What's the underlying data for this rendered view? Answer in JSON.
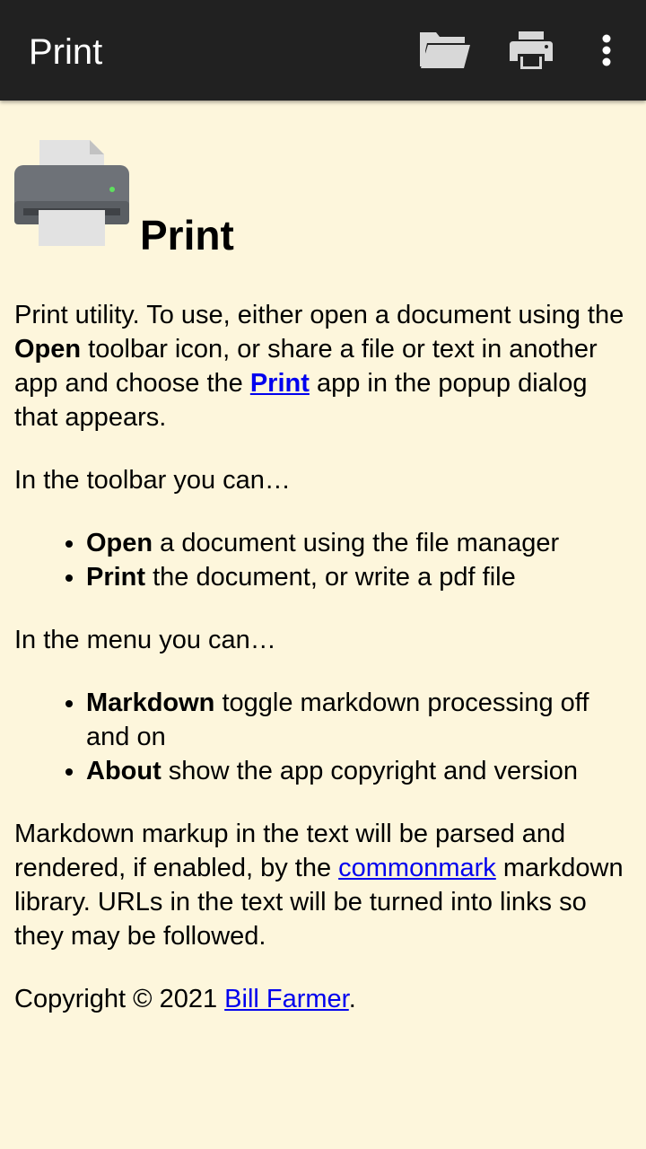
{
  "toolbar": {
    "title": "Print",
    "icons": [
      "folder-open-icon",
      "print-icon",
      "more-vert-icon"
    ]
  },
  "header": {
    "icon": "printer-icon",
    "title": "Print"
  },
  "intro": {
    "t1": "Print utility. To use, either open a document using the ",
    "open_bold": "Open",
    "t2": " toolbar icon, or share a file or text in another app and choose the ",
    "print_link": "Print",
    "t3": " app in the popup dialog that appears."
  },
  "toolbar_section": {
    "heading": "In the toolbar you can…",
    "items": [
      {
        "bold": "Open",
        "text": " a document using the file manager"
      },
      {
        "bold": "Print",
        "text": " the document, or write a pdf file"
      }
    ]
  },
  "menu_section": {
    "heading": "In the menu you can…",
    "items": [
      {
        "bold": "Markdown",
        "text": " toggle markdown processing off and on"
      },
      {
        "bold": "About",
        "text": " show the app copyright and version"
      }
    ]
  },
  "markdown_note": {
    "t1": "Markdown markup in the text will be parsed and rendered, if enabled, by the ",
    "link": "commonmark",
    "t2": " markdown library. URLs in the text will be turned into links so they may be followed."
  },
  "copyright": {
    "t1": "Copyright © 2021 ",
    "link": "Bill Farmer",
    "t2": "."
  },
  "colors": {
    "toolbar_bg": "#212121",
    "page_bg": "#fdf6dc",
    "link": "#0000ee"
  }
}
